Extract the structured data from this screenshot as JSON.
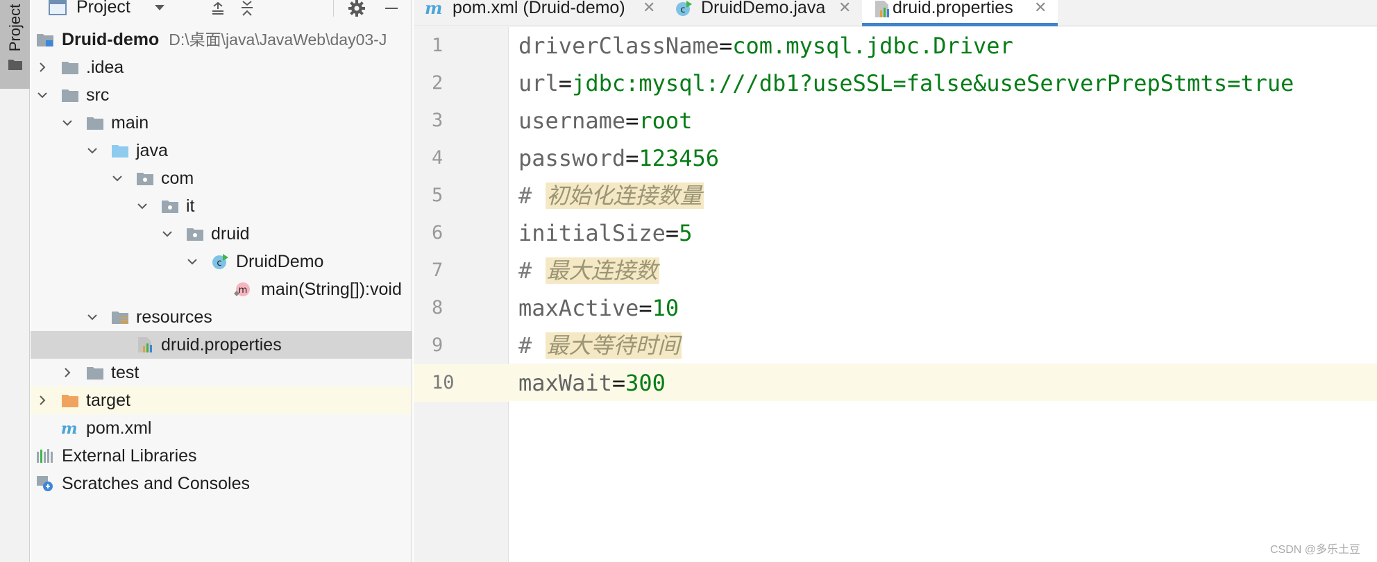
{
  "tool_stripe": {
    "project_label": "Project",
    "folder_icon": "folder-icon"
  },
  "project_panel": {
    "view_label": "Project",
    "tree": {
      "root": {
        "name": "Druid-demo",
        "path": "D:\\桌面\\java\\JavaWeb\\day03-J"
      },
      "idea": ".idea",
      "src": "src",
      "main": "main",
      "java": "java",
      "com": "com",
      "it": "it",
      "druid": "druid",
      "druid_demo": "DruidDemo",
      "main_method": "main(String[]):void",
      "resources": "resources",
      "druid_properties": "druid.properties",
      "test": "test",
      "target": "target",
      "pom": "pom.xml",
      "external_libraries": "External Libraries",
      "scratches": "Scratches and Consoles"
    }
  },
  "tabs": [
    {
      "label": "pom.xml (Druid-demo)",
      "icon": "maven-icon"
    },
    {
      "label": "DruidDemo.java",
      "icon": "java-class-icon"
    },
    {
      "label": "druid.properties",
      "icon": "properties-file-icon",
      "active": true
    }
  ],
  "editor": {
    "line_numbers": [
      "1",
      "2",
      "3",
      "4",
      "5",
      "6",
      "7",
      "8",
      "9",
      "10"
    ],
    "current_line": "10",
    "lines": [
      {
        "key": "driverClassName",
        "value": "com.mysql.jdbc.Driver"
      },
      {
        "key": "url",
        "value": "jdbc:mysql:///db1?useSSL=false&useServerPrepStmts=true"
      },
      {
        "key": "username",
        "value": "root"
      },
      {
        "key": "password",
        "value": "123456"
      },
      {
        "comment": "初始化连接数量"
      },
      {
        "key": "initialSize",
        "value": "5"
      },
      {
        "comment": "最大连接数"
      },
      {
        "key": "maxActive",
        "value": "10"
      },
      {
        "comment": "最大等待时间"
      },
      {
        "key": "maxWait",
        "value": "300"
      }
    ],
    "eq": "=",
    "hash": "#"
  },
  "watermark": "CSDN @多乐土豆",
  "colors": {
    "key": "#656565",
    "value": "#067d17",
    "comment": "#9b9475",
    "comment_bg": "#f4e9c4",
    "current_line_bg": "#fcfae6",
    "selection_bg": "#d5d5d5",
    "tab_underline": "#4083c9"
  }
}
